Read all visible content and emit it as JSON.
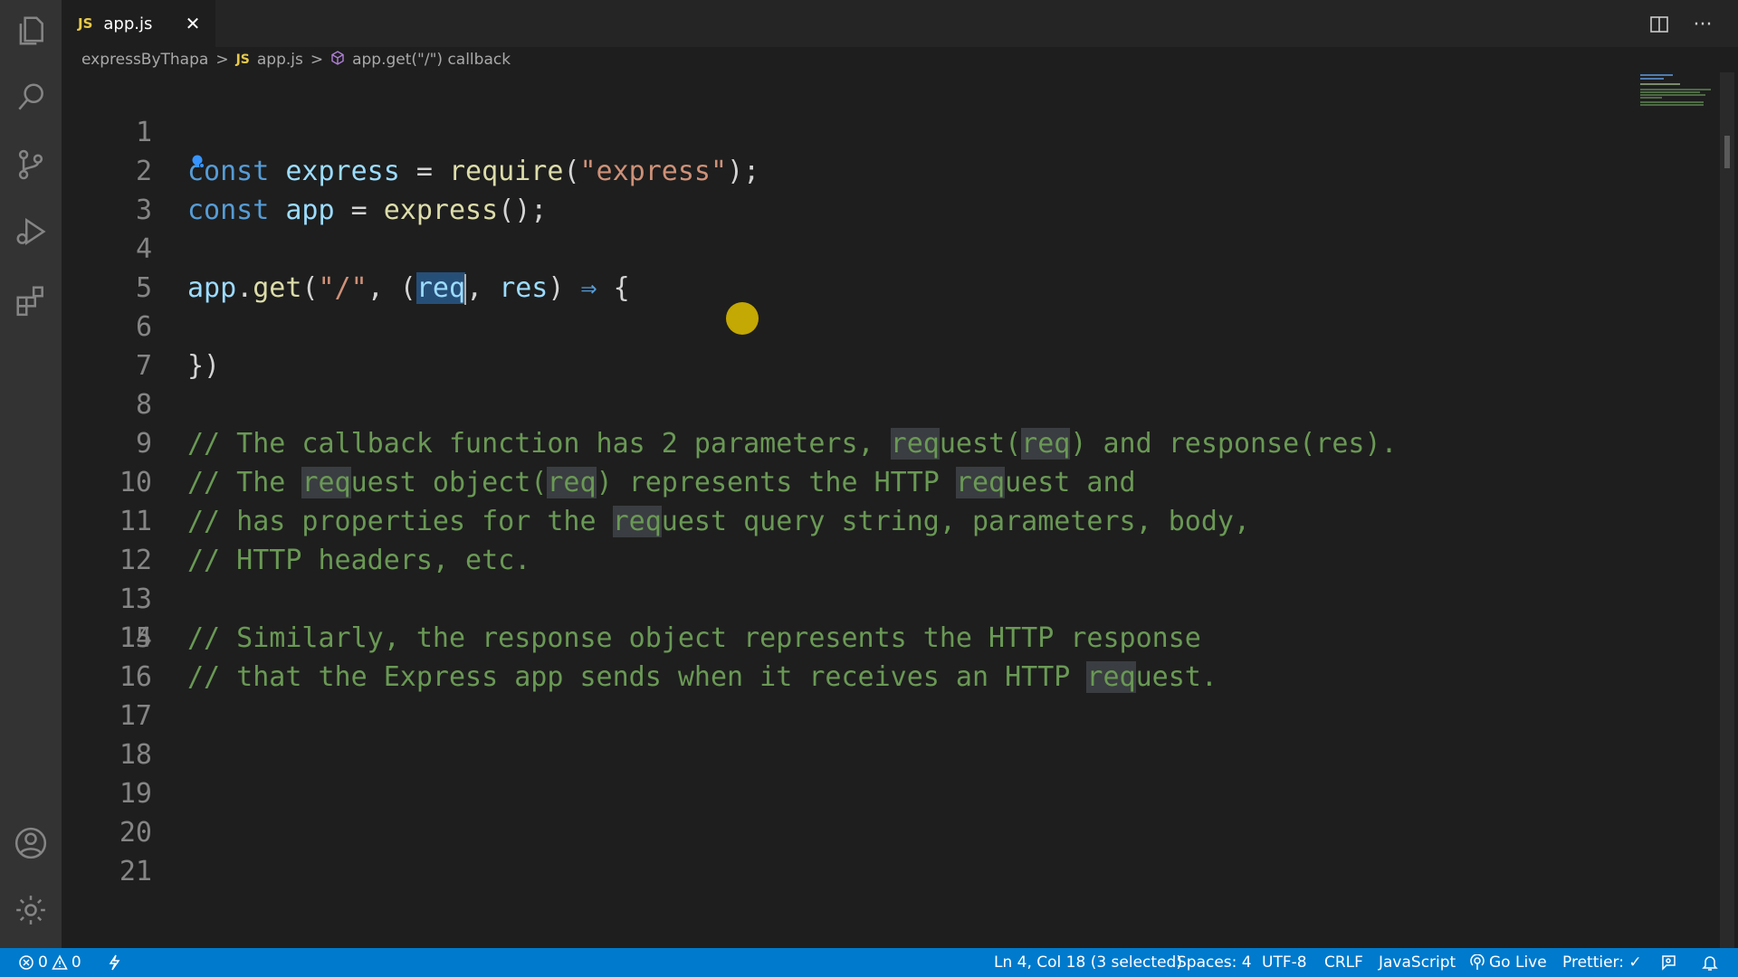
{
  "tab": {
    "lang": "JS",
    "name": "app.js",
    "close": "✕"
  },
  "breadcrumb": {
    "folder": "expressByThapa",
    "sep1": ">",
    "lang": "JS",
    "file": "app.js",
    "sep2": ">",
    "symbol": "app.get(\"/\") callback"
  },
  "lines": [
    {
      "n": "1"
    },
    {
      "n": "2"
    },
    {
      "n": "3"
    },
    {
      "n": "4"
    },
    {
      "n": "5"
    },
    {
      "n": "6"
    },
    {
      "n": "7"
    },
    {
      "n": "8"
    },
    {
      "n": "9"
    },
    {
      "n": "10"
    },
    {
      "n": "11"
    },
    {
      "n": "12"
    },
    {
      "n": "13"
    },
    {
      "n": "14"
    },
    {
      "n": "15"
    },
    {
      "n": "16"
    },
    {
      "n": "17"
    },
    {
      "n": "18"
    },
    {
      "n": "19"
    },
    {
      "n": "20"
    },
    {
      "n": "21"
    }
  ],
  "code": {
    "l1": {
      "kw": "const",
      "var": "express",
      "eq": " = ",
      "fn": "require",
      "open": "(",
      "str": "\"express\"",
      "close": ");"
    },
    "l2": {
      "kw": "const",
      "var": "app",
      "eq": " = ",
      "fn": "express",
      "rest": "();"
    },
    "l4": {
      "obj": "app",
      "dot": ".",
      "fn": "get",
      "open": "(",
      "str": "\"/\"",
      "comma": ", (",
      "p1": "req",
      "comma2": ", ",
      "p2": "res",
      "close": ") ",
      "arrow": "⇒",
      "brace": " {"
    },
    "l6": {
      "text": "})"
    },
    "l8": {
      "a": "// The callback function has 2 parameters, ",
      "h1": "req",
      "b": "uest(",
      "h2": "req",
      "c": ") and response(res)."
    },
    "l9": {
      "a": "// The ",
      "h1": "req",
      "b": "uest object(",
      "h2": "req",
      "c": ") represents the HTTP ",
      "h3": "req",
      "d": "uest and"
    },
    "l10": {
      "a": "// has properties for the ",
      "h1": "req",
      "b": "uest query string, parameters, body,"
    },
    "l11": {
      "a": "// HTTP headers, etc."
    },
    "l13": {
      "a": "// Similarly, the response object represents the HTTP response"
    },
    "l14": {
      "a": "// that the Express app sends when it receives an HTTP ",
      "h1": "req",
      "b": "uest."
    }
  },
  "status": {
    "errors": "0",
    "warnings": "0",
    "position": "Ln 4, Col 18 (3 selected)",
    "spaces": "Spaces: 4",
    "encoding": "UTF-8",
    "eol": "CRLF",
    "language": "JavaScript",
    "golive": "Go Live",
    "prettier": "Prettier: ✓"
  },
  "colors": {
    "accent": "#007acc",
    "keyword": "#569cd6",
    "comment": "#6a9955",
    "string": "#ce9178",
    "function": "#dcdcaa",
    "variable": "#9cdcfe"
  },
  "icons": [
    "explorer-icon",
    "search-icon",
    "source-control-icon",
    "run-debug-icon",
    "extensions-icon",
    "account-icon",
    "settings-gear-icon",
    "split-editor-icon",
    "more-actions-icon",
    "symbol-method-icon",
    "lightbulb-icon",
    "error-icon",
    "warning-icon",
    "remote-icon",
    "golive-icon",
    "feedback-icon",
    "bell-icon"
  ]
}
